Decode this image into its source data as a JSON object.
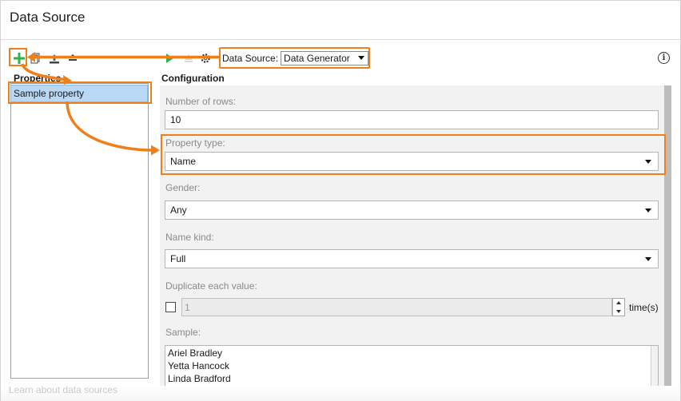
{
  "window": {
    "title": "Data Source"
  },
  "toolbar": {
    "data_source_label": "Data Source:",
    "data_source_value": "Data Generator",
    "icons": [
      "add-icon",
      "copy-icon",
      "move-down-icon",
      "move-up-icon",
      "run-icon",
      "clear-icon",
      "settings-icon",
      "info-icon"
    ],
    "colors": {
      "add": "#2db24a",
      "run": "#2db24a",
      "highlight": "#f07f1a"
    }
  },
  "properties": {
    "header": "Properties",
    "items": [
      {
        "label": "Sample property",
        "selected": true
      }
    ]
  },
  "configuration": {
    "header": "Configuration",
    "rows_label": "Number of rows:",
    "rows_value": "10",
    "property_type_label": "Property type:",
    "property_type_value": "Name",
    "gender_label": "Gender:",
    "gender_value": "Any",
    "name_kind_label": "Name kind:",
    "name_kind_value": "Full",
    "duplicate_label": "Duplicate each value:",
    "duplicate_checked": false,
    "duplicate_value": "1",
    "duplicate_suffix": "time(s)",
    "sample_label": "Sample:",
    "sample_values": [
      "Ariel Bradley",
      "Yetta Hancock",
      "Linda Bradford"
    ]
  },
  "footer": {
    "link_text": "Learn about data sources"
  }
}
